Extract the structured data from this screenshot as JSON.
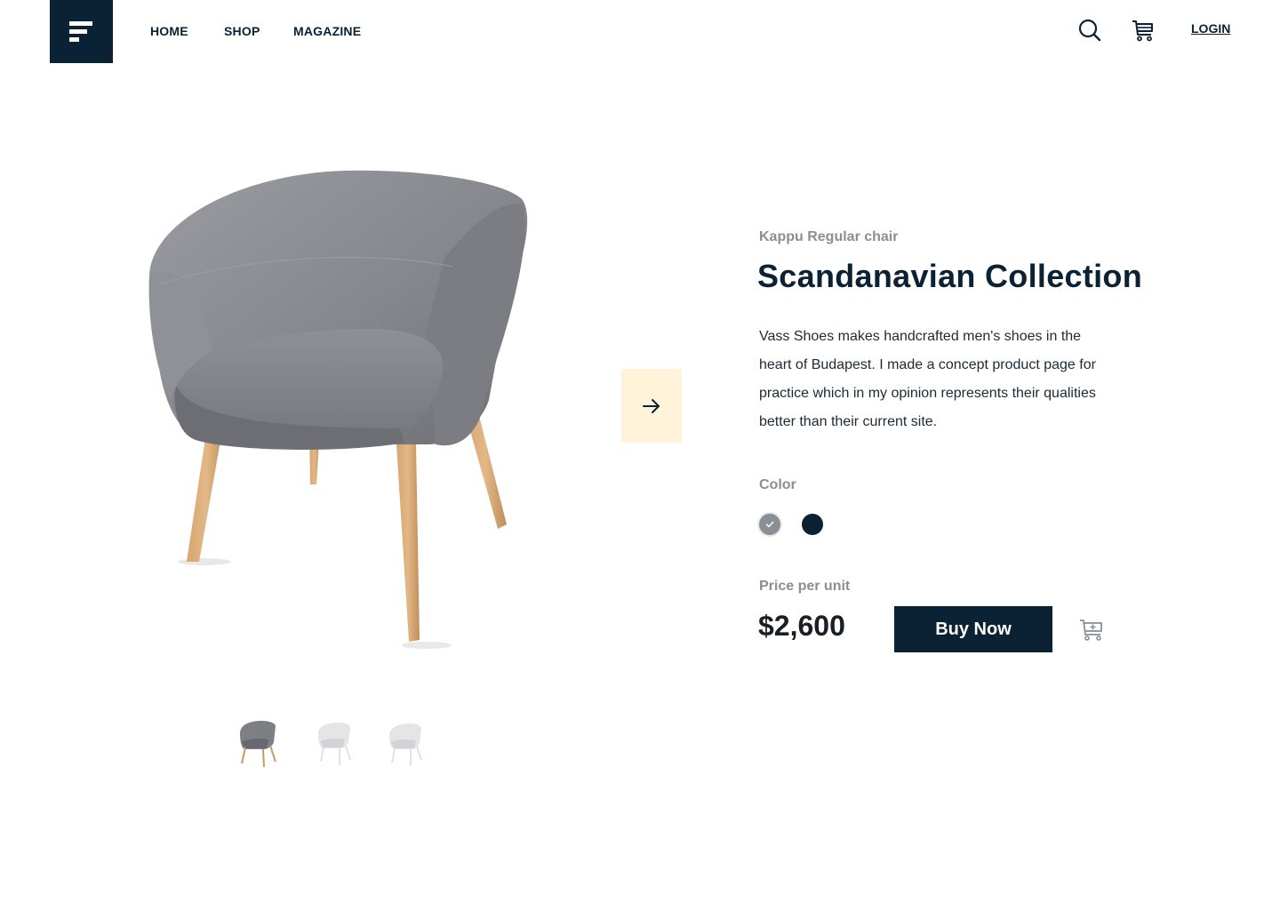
{
  "nav": {
    "items": [
      {
        "label": "HOME"
      },
      {
        "label": "SHOP"
      },
      {
        "label": "MAGAZINE"
      }
    ],
    "login_label": "LOGIN"
  },
  "icons": {
    "logo": "menu-lines-icon",
    "search": "search-icon",
    "cart": "cart-icon",
    "next": "arrow-right-icon",
    "add_to_cart": "add-to-cart-icon",
    "check": "check-icon"
  },
  "product": {
    "subtitle": "Kappu Regular chair",
    "title": "Scandanavian Collection",
    "description": "Vass Shoes makes handcrafted men's shoes in the heart of Budapest. I made a concept product page for practice which in my opinion represents their qualities better than their current site.",
    "color_label": "Color",
    "colors": [
      {
        "name": "grey",
        "hex": "#8a8f95",
        "selected": true
      },
      {
        "name": "navy",
        "hex": "#0a2233",
        "selected": false
      }
    ],
    "price_label": "Price per unit",
    "price": "$2,600",
    "buy_label": "Buy Now"
  },
  "thumbnails": [
    {
      "variant": "grey-fabric-wood-legs",
      "selected": true
    },
    {
      "variant": "white",
      "selected": false
    },
    {
      "variant": "white",
      "selected": false
    }
  ],
  "theme": {
    "primary": "#0a2233",
    "muted_text": "#8a8f95",
    "accent_bg": "#fff3da"
  }
}
